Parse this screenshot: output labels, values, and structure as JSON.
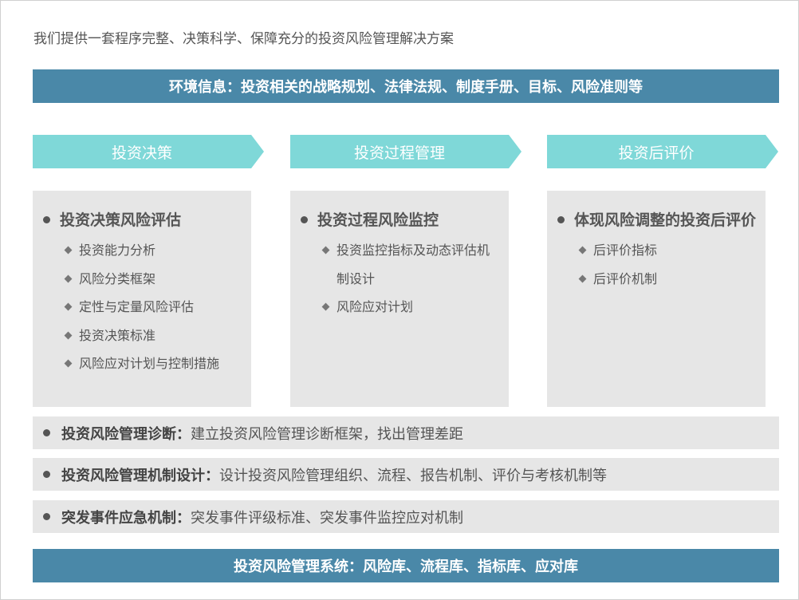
{
  "intro": "我们提供一套程序完整、决策科学、保障充分的投资风险管理解决方案",
  "top_bar": "环境信息：投资相关的战略规划、法律法规、制度手册、目标、风险准则等",
  "stages": [
    {
      "arrow": "投资决策",
      "title": "投资决策风险评估",
      "items": [
        "投资能力分析",
        "风险分类框架",
        "定性与定量风险评估",
        "投资决策标准",
        "风险应对计划与控制措施"
      ]
    },
    {
      "arrow": "投资过程管理",
      "title": "投资过程风险监控",
      "items": [
        "投资监控指标及动态评估机制设计",
        "风险应对计划"
      ]
    },
    {
      "arrow": "投资后评价",
      "title": "体现风险调整的投资后评价",
      "items": [
        "后评价指标",
        "后评价机制"
      ]
    }
  ],
  "rows": [
    {
      "label": "投资风险管理诊断",
      "sep": "：",
      "text": "建立投资风险管理诊断框架，找出管理差距"
    },
    {
      "label": "投资风险管理机制设计",
      "sep": "：",
      "text": "设计投资风险管理组织、流程、报告机制、评价与考核机制等"
    },
    {
      "label": "突发事件应急机制",
      "sep": "：",
      "text": "突发事件评级标准、突发事件监控应对机制"
    }
  ],
  "bottom_bar": "投资风险管理系统：风险库、流程库、指标库、应对库"
}
